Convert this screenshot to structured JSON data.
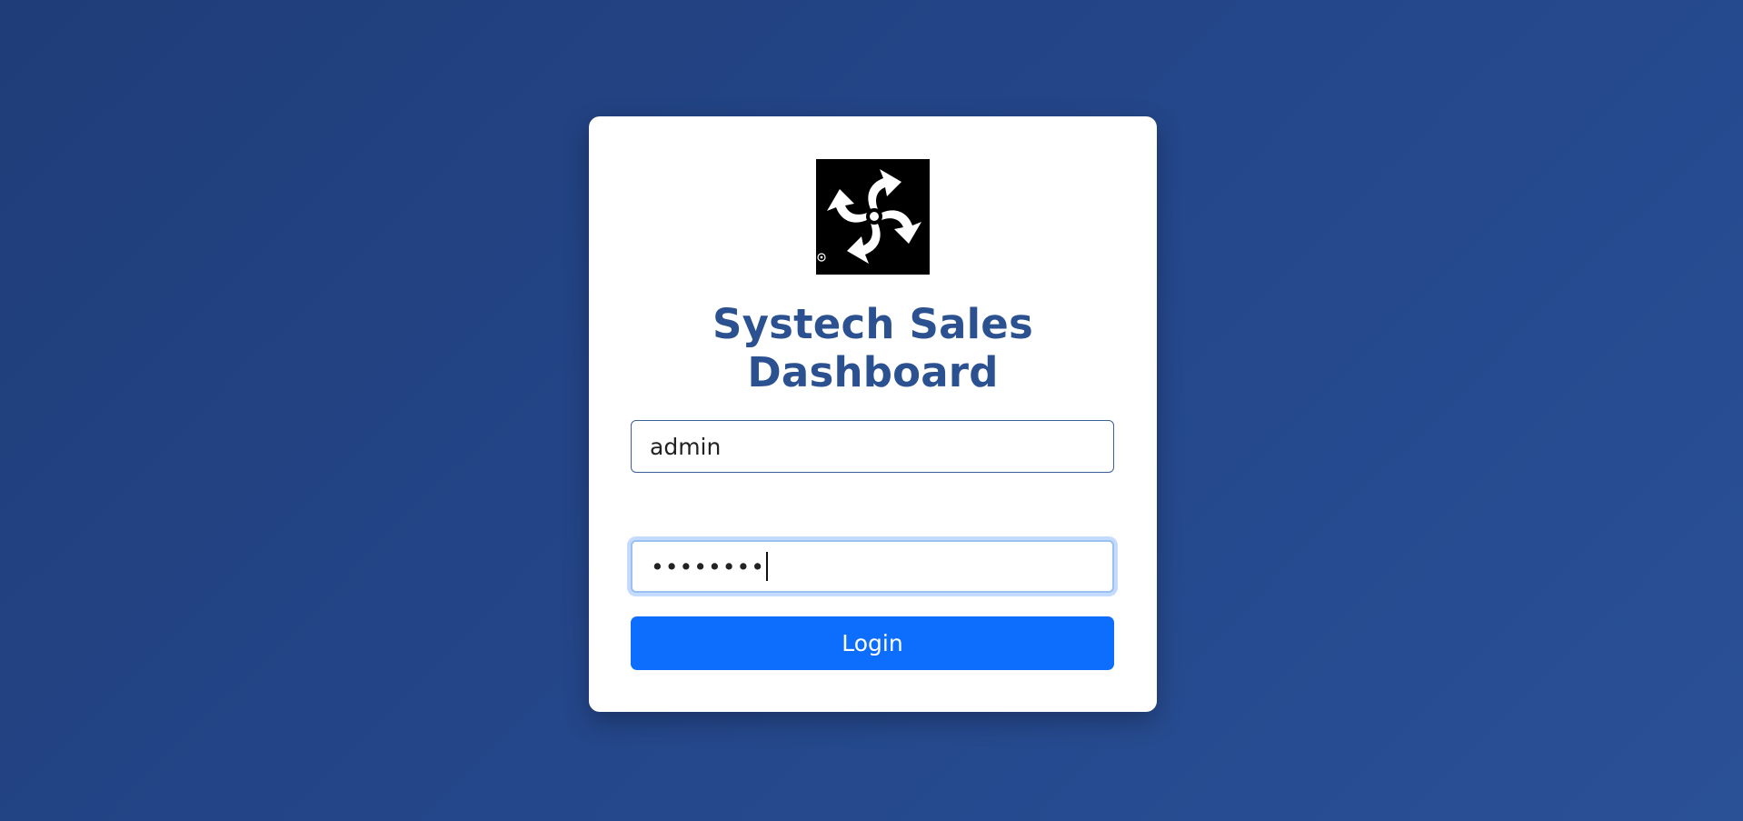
{
  "login": {
    "title": "Systech Sales Dashboard",
    "username_value": "admin",
    "password_mask": "••••••••",
    "login_label": "Login"
  },
  "logo": {
    "icon": "pinwheel-arrows-logo"
  },
  "colors": {
    "background": "#24468a",
    "title": "#2b5191",
    "button": "#0d6efd",
    "card": "#ffffff"
  }
}
